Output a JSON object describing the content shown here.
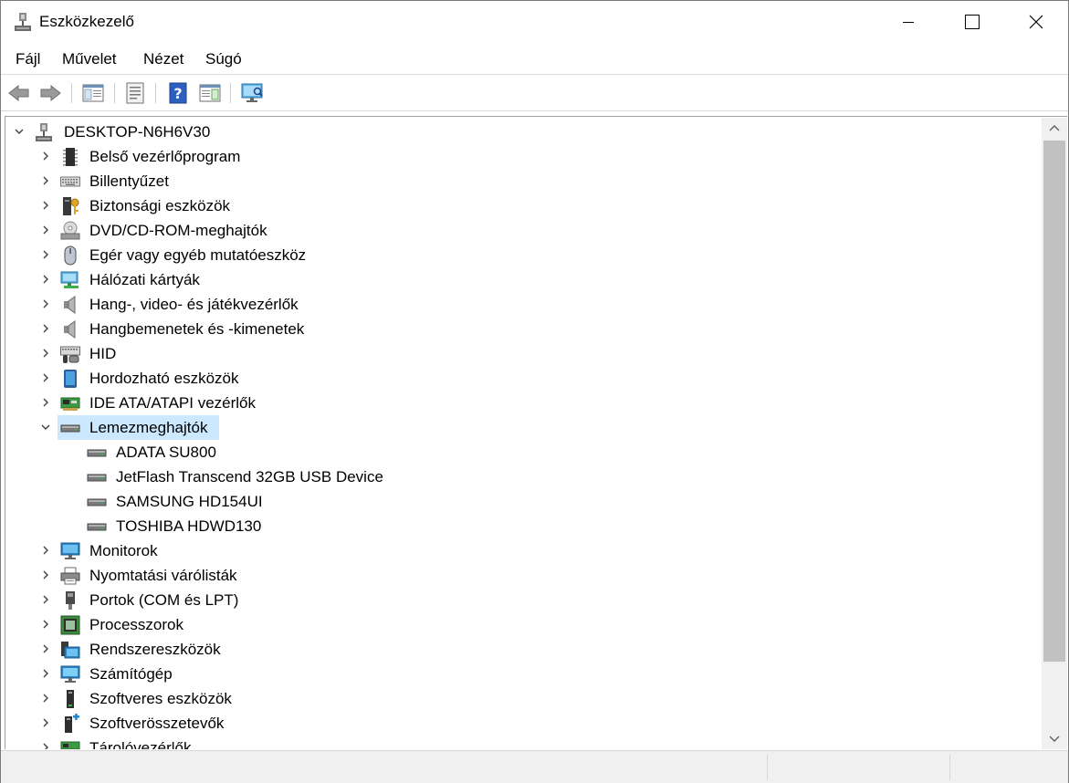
{
  "window": {
    "title": "Eszközkezelő",
    "minimize_icon": "minimize-icon",
    "maximize_icon": "maximize-icon",
    "close_icon": "close-icon"
  },
  "menu": [
    "Fájl",
    "Művelet",
    "Nézet",
    "Súgó"
  ],
  "toolbar": {
    "buttons": [
      "back-arrow-icon",
      "forward-arrow-icon",
      "show-hide-console-tree-icon",
      "properties-icon",
      "help-icon",
      "show-action-pane-icon",
      "scan-hardware-changes-icon"
    ]
  },
  "tree": {
    "root": "DESKTOP-N6H6V30",
    "categories": [
      {
        "label": "Belső vezérlőprogram",
        "icon": "firmware-chip-icon"
      },
      {
        "label": "Billentyűzet",
        "icon": "keyboard-icon"
      },
      {
        "label": "Biztonsági eszközök",
        "icon": "security-key-icon"
      },
      {
        "label": "DVD/CD-ROM-meghajtók",
        "icon": "optical-drive-icon"
      },
      {
        "label": "Egér vagy egyéb mutatóeszköz",
        "icon": "mouse-icon"
      },
      {
        "label": "Hálózati kártyák",
        "icon": "network-adapter-icon"
      },
      {
        "label": "Hang-, video- és játékvezérlők",
        "icon": "speaker-icon"
      },
      {
        "label": "Hangbemenetek és -kimenetek",
        "icon": "speaker-icon"
      },
      {
        "label": "HID",
        "icon": "hid-icon"
      },
      {
        "label": "Hordozható eszközök",
        "icon": "portable-device-icon"
      },
      {
        "label": "IDE ATA/ATAPI vezérlők",
        "icon": "ide-controller-icon"
      },
      {
        "label": "Lemezmeghajtók",
        "icon": "disk-drive-icon",
        "expanded": true,
        "selected": true,
        "children": [
          "ADATA SU800",
          "JetFlash Transcend 32GB USB Device",
          "SAMSUNG HD154UI",
          "TOSHIBA HDWD130"
        ]
      },
      {
        "label": "Monitorok",
        "icon": "monitor-icon"
      },
      {
        "label": "Nyomtatási várólisták",
        "icon": "printer-icon"
      },
      {
        "label": "Portok (COM és LPT)",
        "icon": "port-icon"
      },
      {
        "label": "Processzorok",
        "icon": "processor-icon"
      },
      {
        "label": "Rendszereszközök",
        "icon": "system-device-icon"
      },
      {
        "label": "Számítógép",
        "icon": "computer-icon"
      },
      {
        "label": "Szoftveres eszközök",
        "icon": "software-device-icon"
      },
      {
        "label": "Szoftverösszetevők",
        "icon": "software-component-icon"
      },
      {
        "label": "Tárolóvezérlők",
        "icon": "storage-controller-icon"
      }
    ]
  },
  "colors": {
    "selection": "#cce8ff",
    "scrollbar_thumb": "#c1c1c1",
    "statusbar": "#f0f0f0"
  }
}
